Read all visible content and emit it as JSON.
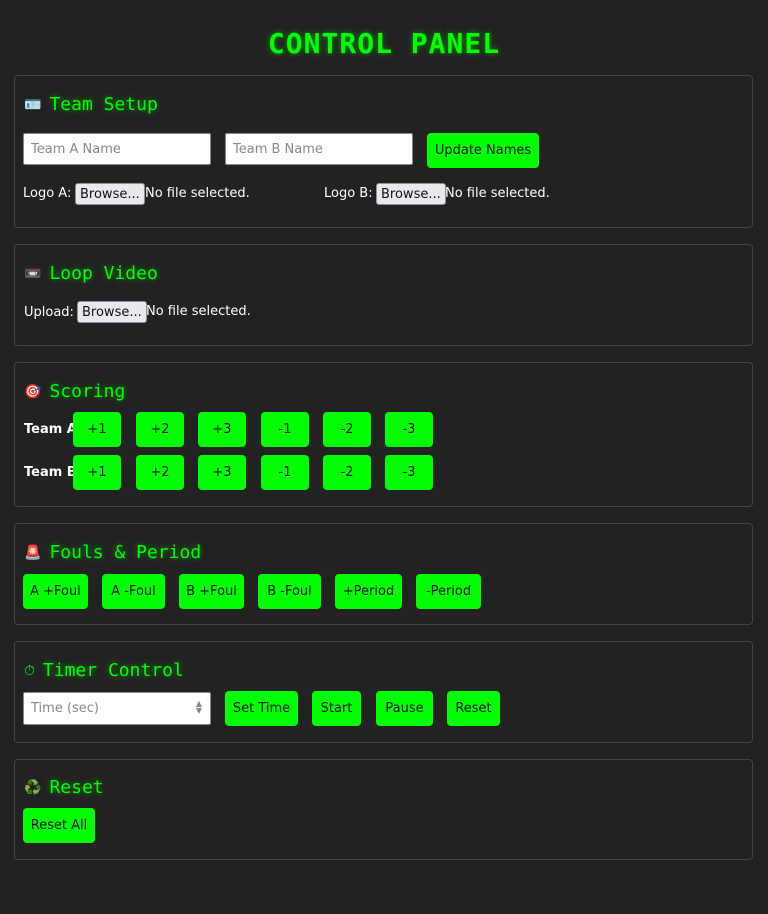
{
  "title": "CONTROL PANEL",
  "team_setup": {
    "heading": "Team Setup",
    "icon": "🪪",
    "team_a_placeholder": "Team A Name",
    "team_b_placeholder": "Team B Name",
    "update_label": "Update Names",
    "logo_a_label": "Logo A:",
    "logo_b_label": "Logo B:",
    "browse_label": "Browse...",
    "no_file": "No file selected."
  },
  "loop_video": {
    "heading": "Loop Video",
    "icon": "📼",
    "upload_label": "Upload:",
    "browse_label": "Browse...",
    "no_file": "No file selected."
  },
  "scoring": {
    "heading": "Scoring",
    "icon": "🎯",
    "team_a_label": "Team A",
    "team_b_label": "Team B",
    "buttons": [
      "+1",
      "+2",
      "+3",
      "-1",
      "-2",
      "-3"
    ]
  },
  "fouls_period": {
    "heading": "Fouls & Period",
    "icon": "🚨",
    "buttons": [
      "A +Foul",
      "A -Foul",
      "B +Foul",
      "B -Foul",
      "+Period",
      "-Period"
    ]
  },
  "timer": {
    "heading": "Timer Control",
    "icon": "⏱",
    "time_placeholder": "Time (sec)",
    "set_label": "Set Time",
    "start_label": "Start",
    "pause_label": "Pause",
    "reset_label": "Reset"
  },
  "reset": {
    "heading": "Reset",
    "icon": "♻️",
    "reset_all_label": "Reset All"
  },
  "colors": {
    "accent": "#00ff00",
    "background": "#222222",
    "border": "#444444"
  }
}
